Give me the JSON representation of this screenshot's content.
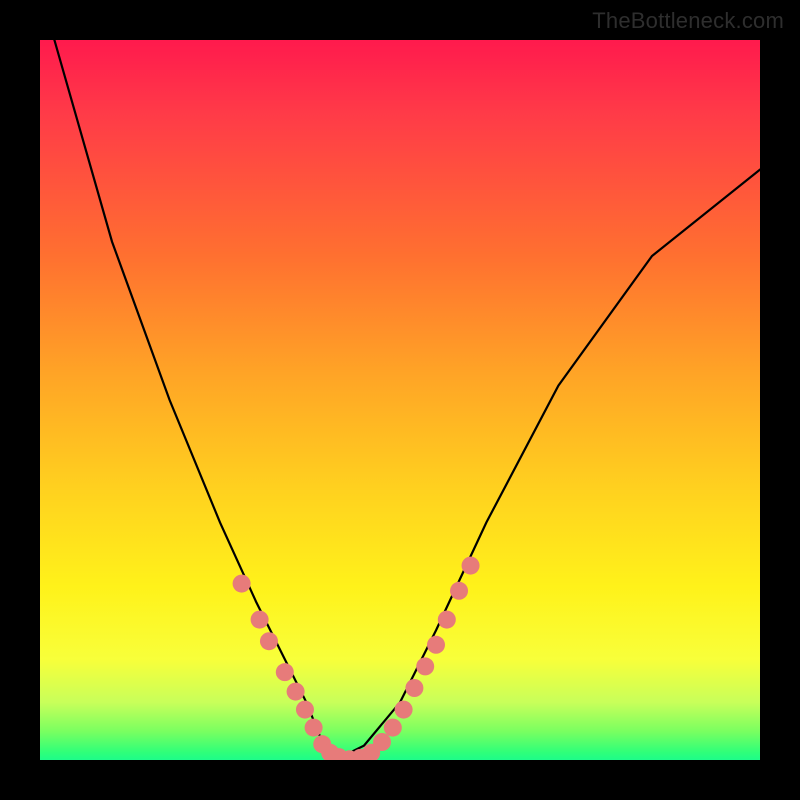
{
  "watermark": "TheBottleneck.com",
  "chart_data": {
    "type": "line",
    "title": "",
    "xlabel": "",
    "ylabel": "",
    "xlim": [
      0,
      1
    ],
    "ylim": [
      0,
      1
    ],
    "series": [
      {
        "name": "bottleneck-curve",
        "x": [
          0.02,
          0.1,
          0.18,
          0.25,
          0.3,
          0.34,
          0.37,
          0.39,
          0.41,
          0.45,
          0.5,
          0.55,
          0.62,
          0.72,
          0.85,
          1.0
        ],
        "values": [
          1.0,
          0.72,
          0.5,
          0.33,
          0.22,
          0.14,
          0.08,
          0.03,
          0.0,
          0.02,
          0.08,
          0.18,
          0.33,
          0.52,
          0.7,
          0.82
        ]
      }
    ],
    "markers": {
      "name": "highlight-dots",
      "color": "#e77b7a",
      "points": [
        {
          "x": 0.28,
          "y": 0.245
        },
        {
          "x": 0.305,
          "y": 0.195
        },
        {
          "x": 0.318,
          "y": 0.165
        },
        {
          "x": 0.34,
          "y": 0.122
        },
        {
          "x": 0.355,
          "y": 0.095
        },
        {
          "x": 0.368,
          "y": 0.07
        },
        {
          "x": 0.38,
          "y": 0.045
        },
        {
          "x": 0.392,
          "y": 0.022
        },
        {
          "x": 0.403,
          "y": 0.01
        },
        {
          "x": 0.415,
          "y": 0.004
        },
        {
          "x": 0.43,
          "y": 0.001
        },
        {
          "x": 0.445,
          "y": 0.003
        },
        {
          "x": 0.46,
          "y": 0.01
        },
        {
          "x": 0.475,
          "y": 0.025
        },
        {
          "x": 0.49,
          "y": 0.045
        },
        {
          "x": 0.505,
          "y": 0.07
        },
        {
          "x": 0.52,
          "y": 0.1
        },
        {
          "x": 0.535,
          "y": 0.13
        },
        {
          "x": 0.55,
          "y": 0.16
        },
        {
          "x": 0.565,
          "y": 0.195
        },
        {
          "x": 0.582,
          "y": 0.235
        },
        {
          "x": 0.598,
          "y": 0.27
        }
      ]
    },
    "annotations": [],
    "legend": null
  }
}
